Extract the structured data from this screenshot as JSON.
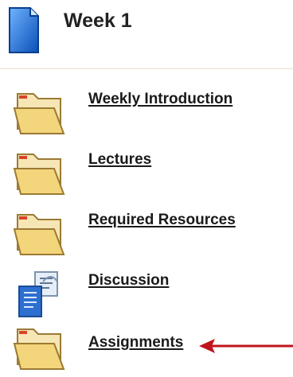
{
  "header": {
    "title": "Week 1",
    "icon": "document-icon"
  },
  "items": [
    {
      "label": "Weekly Introduction",
      "icon": "folder-icon"
    },
    {
      "label": "Lectures",
      "icon": "folder-icon"
    },
    {
      "label": "Required Resources",
      "icon": "folder-icon"
    },
    {
      "label": "Discussion",
      "icon": "discussion-board-icon"
    },
    {
      "label": "Assignments",
      "icon": "folder-icon"
    }
  ],
  "annotation": {
    "arrow_color": "#c0141c",
    "pointer": "arrow-pointer-icon"
  },
  "colors": {
    "folder_body": "#f3d57b",
    "folder_edge": "#9b7a34",
    "folder_tab_red": "#d9432b",
    "doc_blue": "#1f6fd8",
    "divider": "#eadfc8"
  }
}
